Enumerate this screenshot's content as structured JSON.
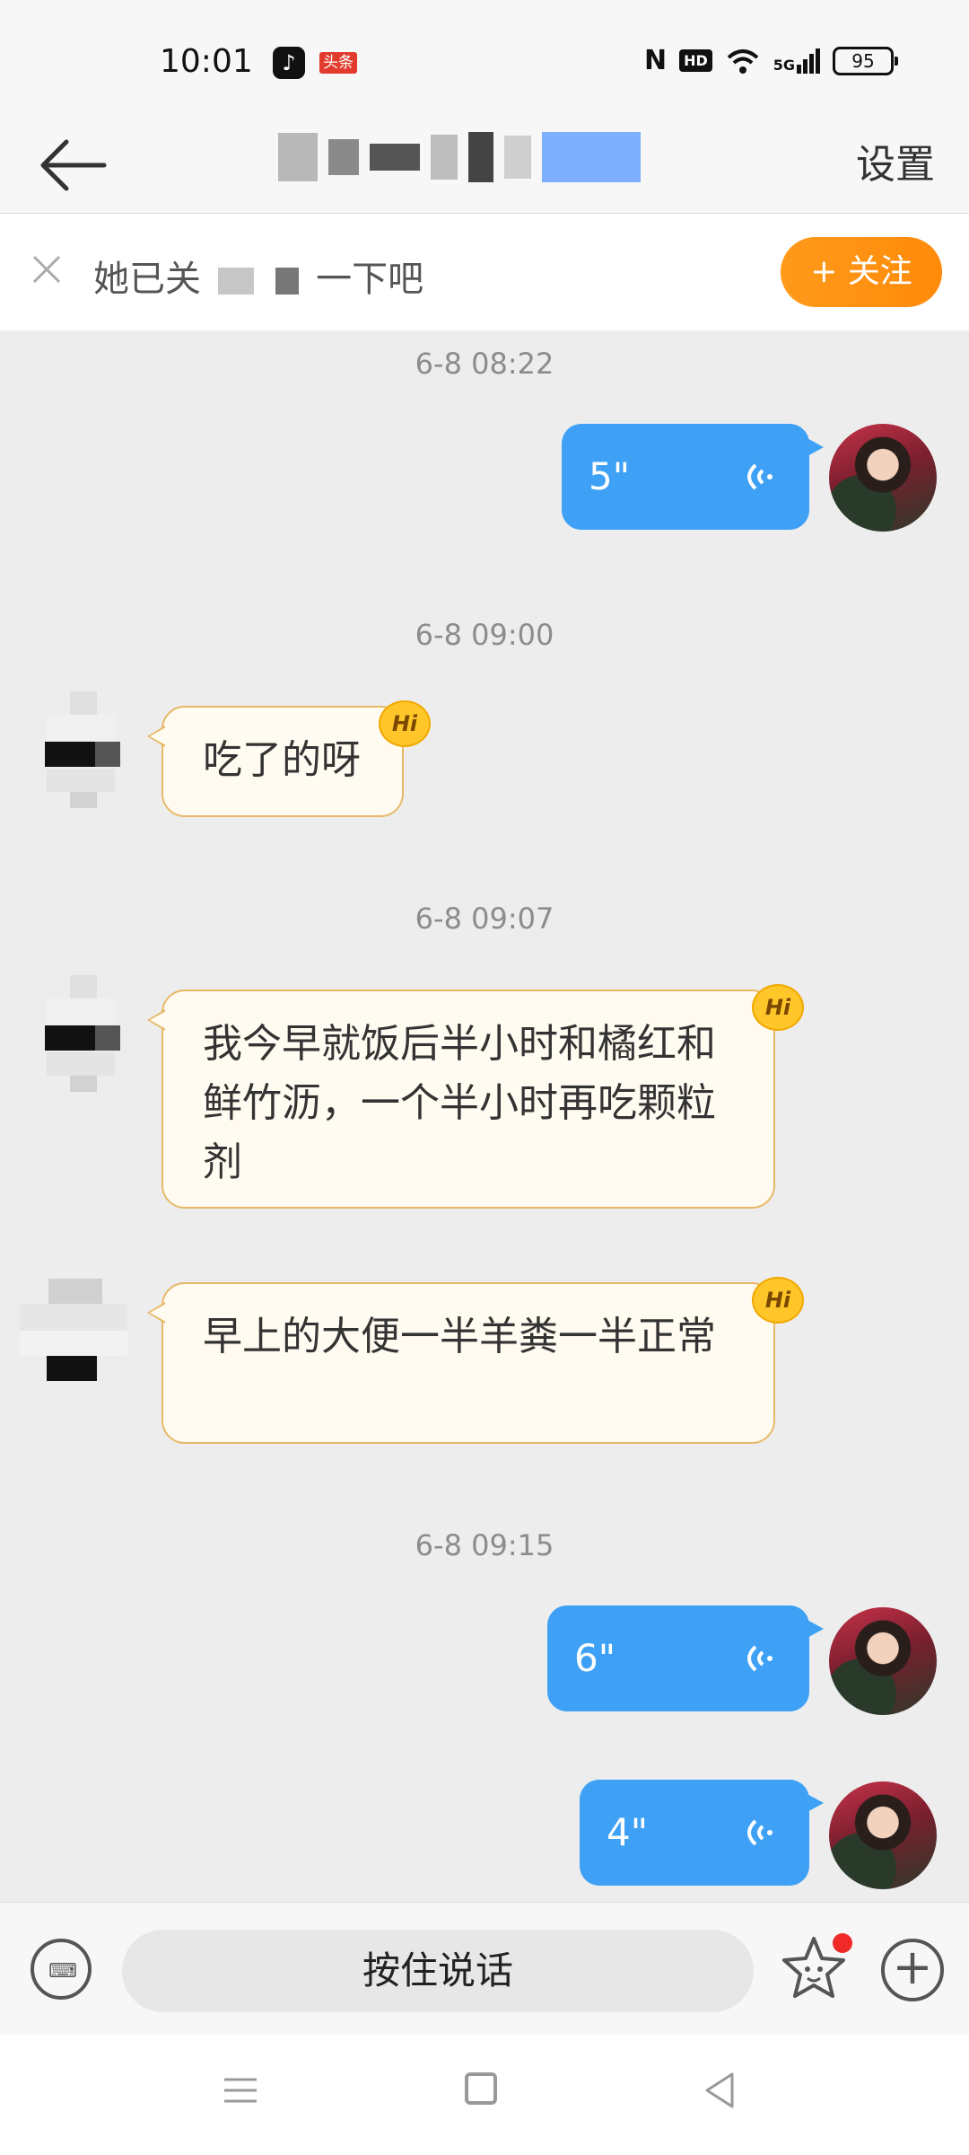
{
  "status_bar": {
    "time": "10:01",
    "app_icons": [
      "tiktok-icon",
      "toutiao-icon"
    ],
    "toutiao_label": "头条",
    "nfc": "N",
    "hd": "HD",
    "network": "5G",
    "battery": "95"
  },
  "header": {
    "back_icon": "back-arrow-icon",
    "settings_label": "设置"
  },
  "follow_bar": {
    "close_icon": "close-icon",
    "text_before": "她已关",
    "text_after": "一下吧",
    "follow_label": "+ 关注"
  },
  "messages": [
    {
      "type": "timestamp",
      "text": "6-8 08:22"
    },
    {
      "type": "voice",
      "sender": "self",
      "duration": "5\""
    },
    {
      "type": "timestamp",
      "text": "6-8 09:00"
    },
    {
      "type": "text",
      "sender": "other",
      "text": "吃了的呀",
      "badge": "Hi"
    },
    {
      "type": "timestamp",
      "text": "6-8 09:07"
    },
    {
      "type": "text",
      "sender": "other",
      "text": "我今早就饭后半小时和橘红和鲜竹沥，一个半小时再吃颗粒剂",
      "badge": "Hi"
    },
    {
      "type": "text",
      "sender": "other",
      "text": "早上的大便一半羊粪一半正常",
      "badge": "Hi"
    },
    {
      "type": "timestamp",
      "text": "6-8 09:15"
    },
    {
      "type": "voice",
      "sender": "self",
      "duration": "6\""
    },
    {
      "type": "voice",
      "sender": "self",
      "duration": "4\""
    }
  ],
  "input_bar": {
    "keyboard_icon": "keyboard-icon",
    "hold_to_talk": "按住说话",
    "emoji_icon": "emoji-icon",
    "plus_icon": "plus-icon"
  },
  "nav_bar": {
    "icons": [
      "menu-icon",
      "home-icon",
      "back-icon"
    ]
  },
  "colors": {
    "accent_blue": "#3ea1f6",
    "follow_orange": "#ff9a1a",
    "incoming_border": "#e8b868",
    "background": "#ededed"
  }
}
